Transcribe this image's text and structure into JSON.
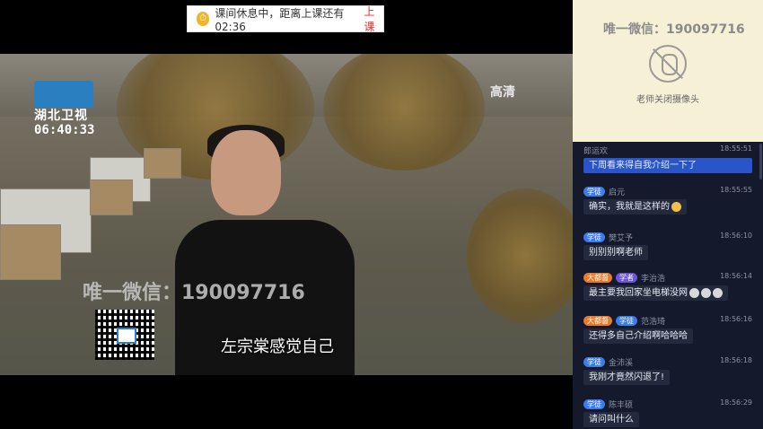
{
  "notice": {
    "text": "课间休息中，距离上课还有02:36",
    "action": "上课"
  },
  "video": {
    "channel": "湖北卫视",
    "clock": "06:40:33",
    "quality": "高清",
    "watermark": "唯一微信：190097716",
    "subtitle": "左宗棠感觉自己"
  },
  "camera": {
    "watermark": "唯一微信：190097716",
    "status": "老师关闭摄像头",
    "icon": "camera-off-icon"
  },
  "chat": {
    "messages": [
      {
        "badges": [],
        "name": "郎运欢",
        "time": "18:55:51",
        "text": "下周看来得自我介绍一下了",
        "highlight": true
      },
      {
        "badges": [
          {
            "label": "学徒",
            "color": "blue"
          }
        ],
        "name": "启元",
        "time": "18:55:55",
        "text": "确实，我就是这样的",
        "emojis": 1
      },
      {
        "badges": [
          {
            "label": "学徒",
            "color": "blue"
          }
        ],
        "name": "樊艾予",
        "time": "18:56:10",
        "text": "别别别啊老师"
      },
      {
        "badges": [
          {
            "label": "大都督",
            "color": "orange"
          },
          {
            "label": "学者",
            "color": "purple"
          }
        ],
        "name": "李治浩",
        "time": "18:56:14",
        "text": "最主要我回家坐电梯没网",
        "emojis": 3
      },
      {
        "badges": [
          {
            "label": "大都督",
            "color": "orange"
          },
          {
            "label": "学徒",
            "color": "blue"
          }
        ],
        "name": "范浩琦",
        "time": "18:56:16",
        "text": "还得多自己介绍啊哈哈哈"
      },
      {
        "badges": [
          {
            "label": "学徒",
            "color": "blue"
          }
        ],
        "name": "金沛溪",
        "time": "18:56:18",
        "text": "我刚才竟然闪退了!"
      },
      {
        "badges": [
          {
            "label": "学徒",
            "color": "blue"
          }
        ],
        "name": "陈丰硕",
        "time": "18:56:29",
        "text": "请问叫什么"
      }
    ]
  }
}
